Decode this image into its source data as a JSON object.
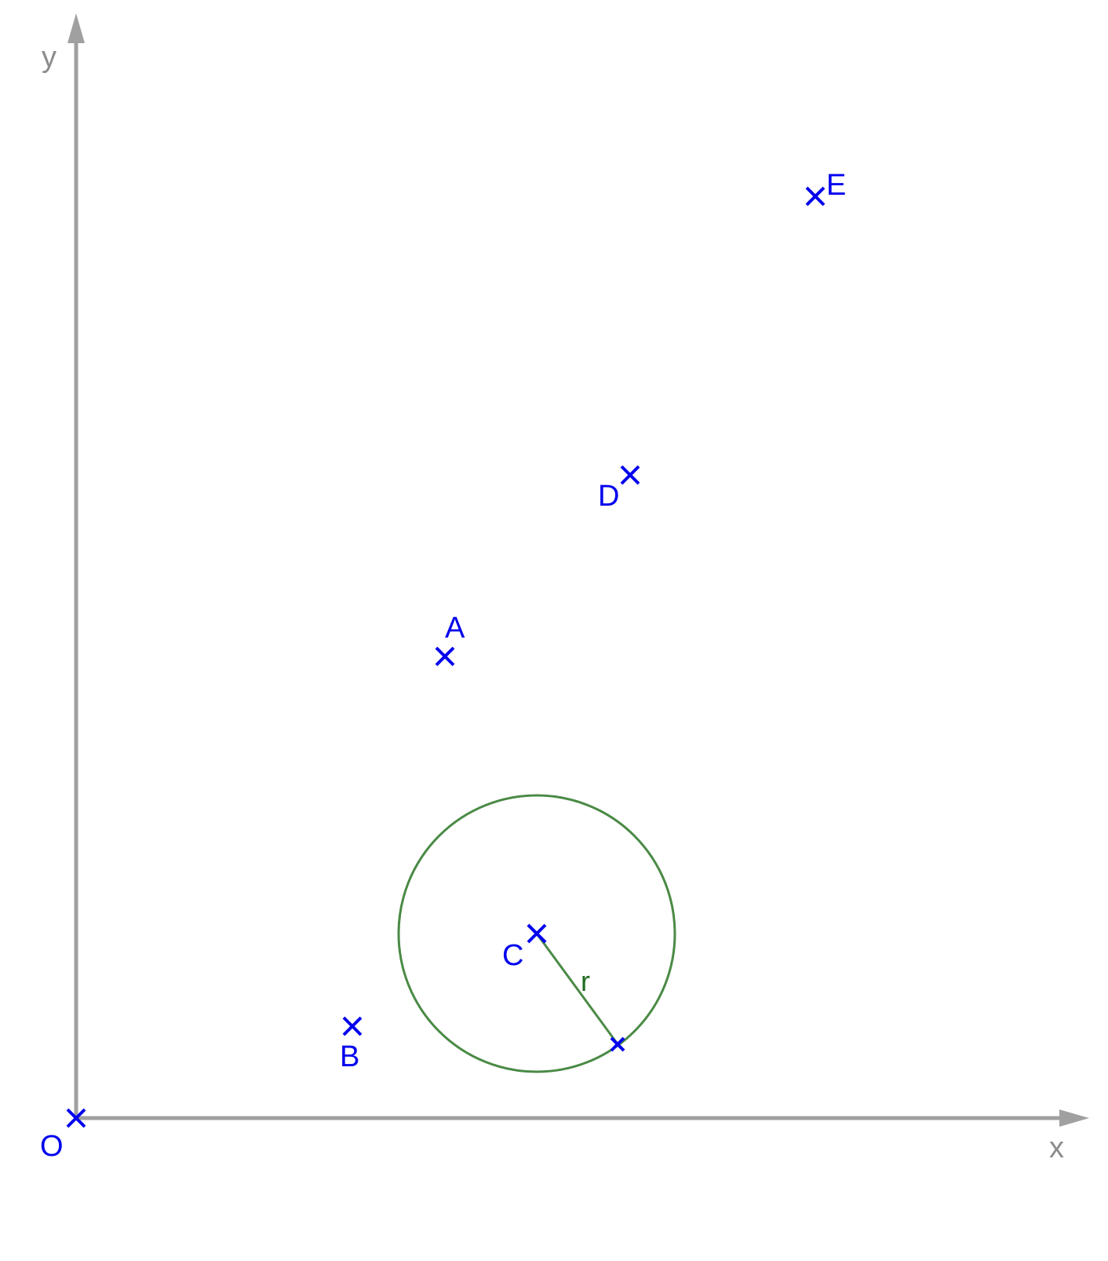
{
  "axes": {
    "x_label": "x",
    "y_label": "y"
  },
  "points": [
    {
      "id": "O",
      "label": "O"
    },
    {
      "id": "A",
      "label": "A"
    },
    {
      "id": "B",
      "label": "B"
    },
    {
      "id": "C",
      "label": "C"
    },
    {
      "id": "D",
      "label": "D"
    },
    {
      "id": "E",
      "label": "E"
    }
  ],
  "circle": {
    "center": "C",
    "radius_label": "r"
  },
  "colors": {
    "points": "#0000ee",
    "axes": "#a0a0a0",
    "circle": "#4a8a45"
  }
}
